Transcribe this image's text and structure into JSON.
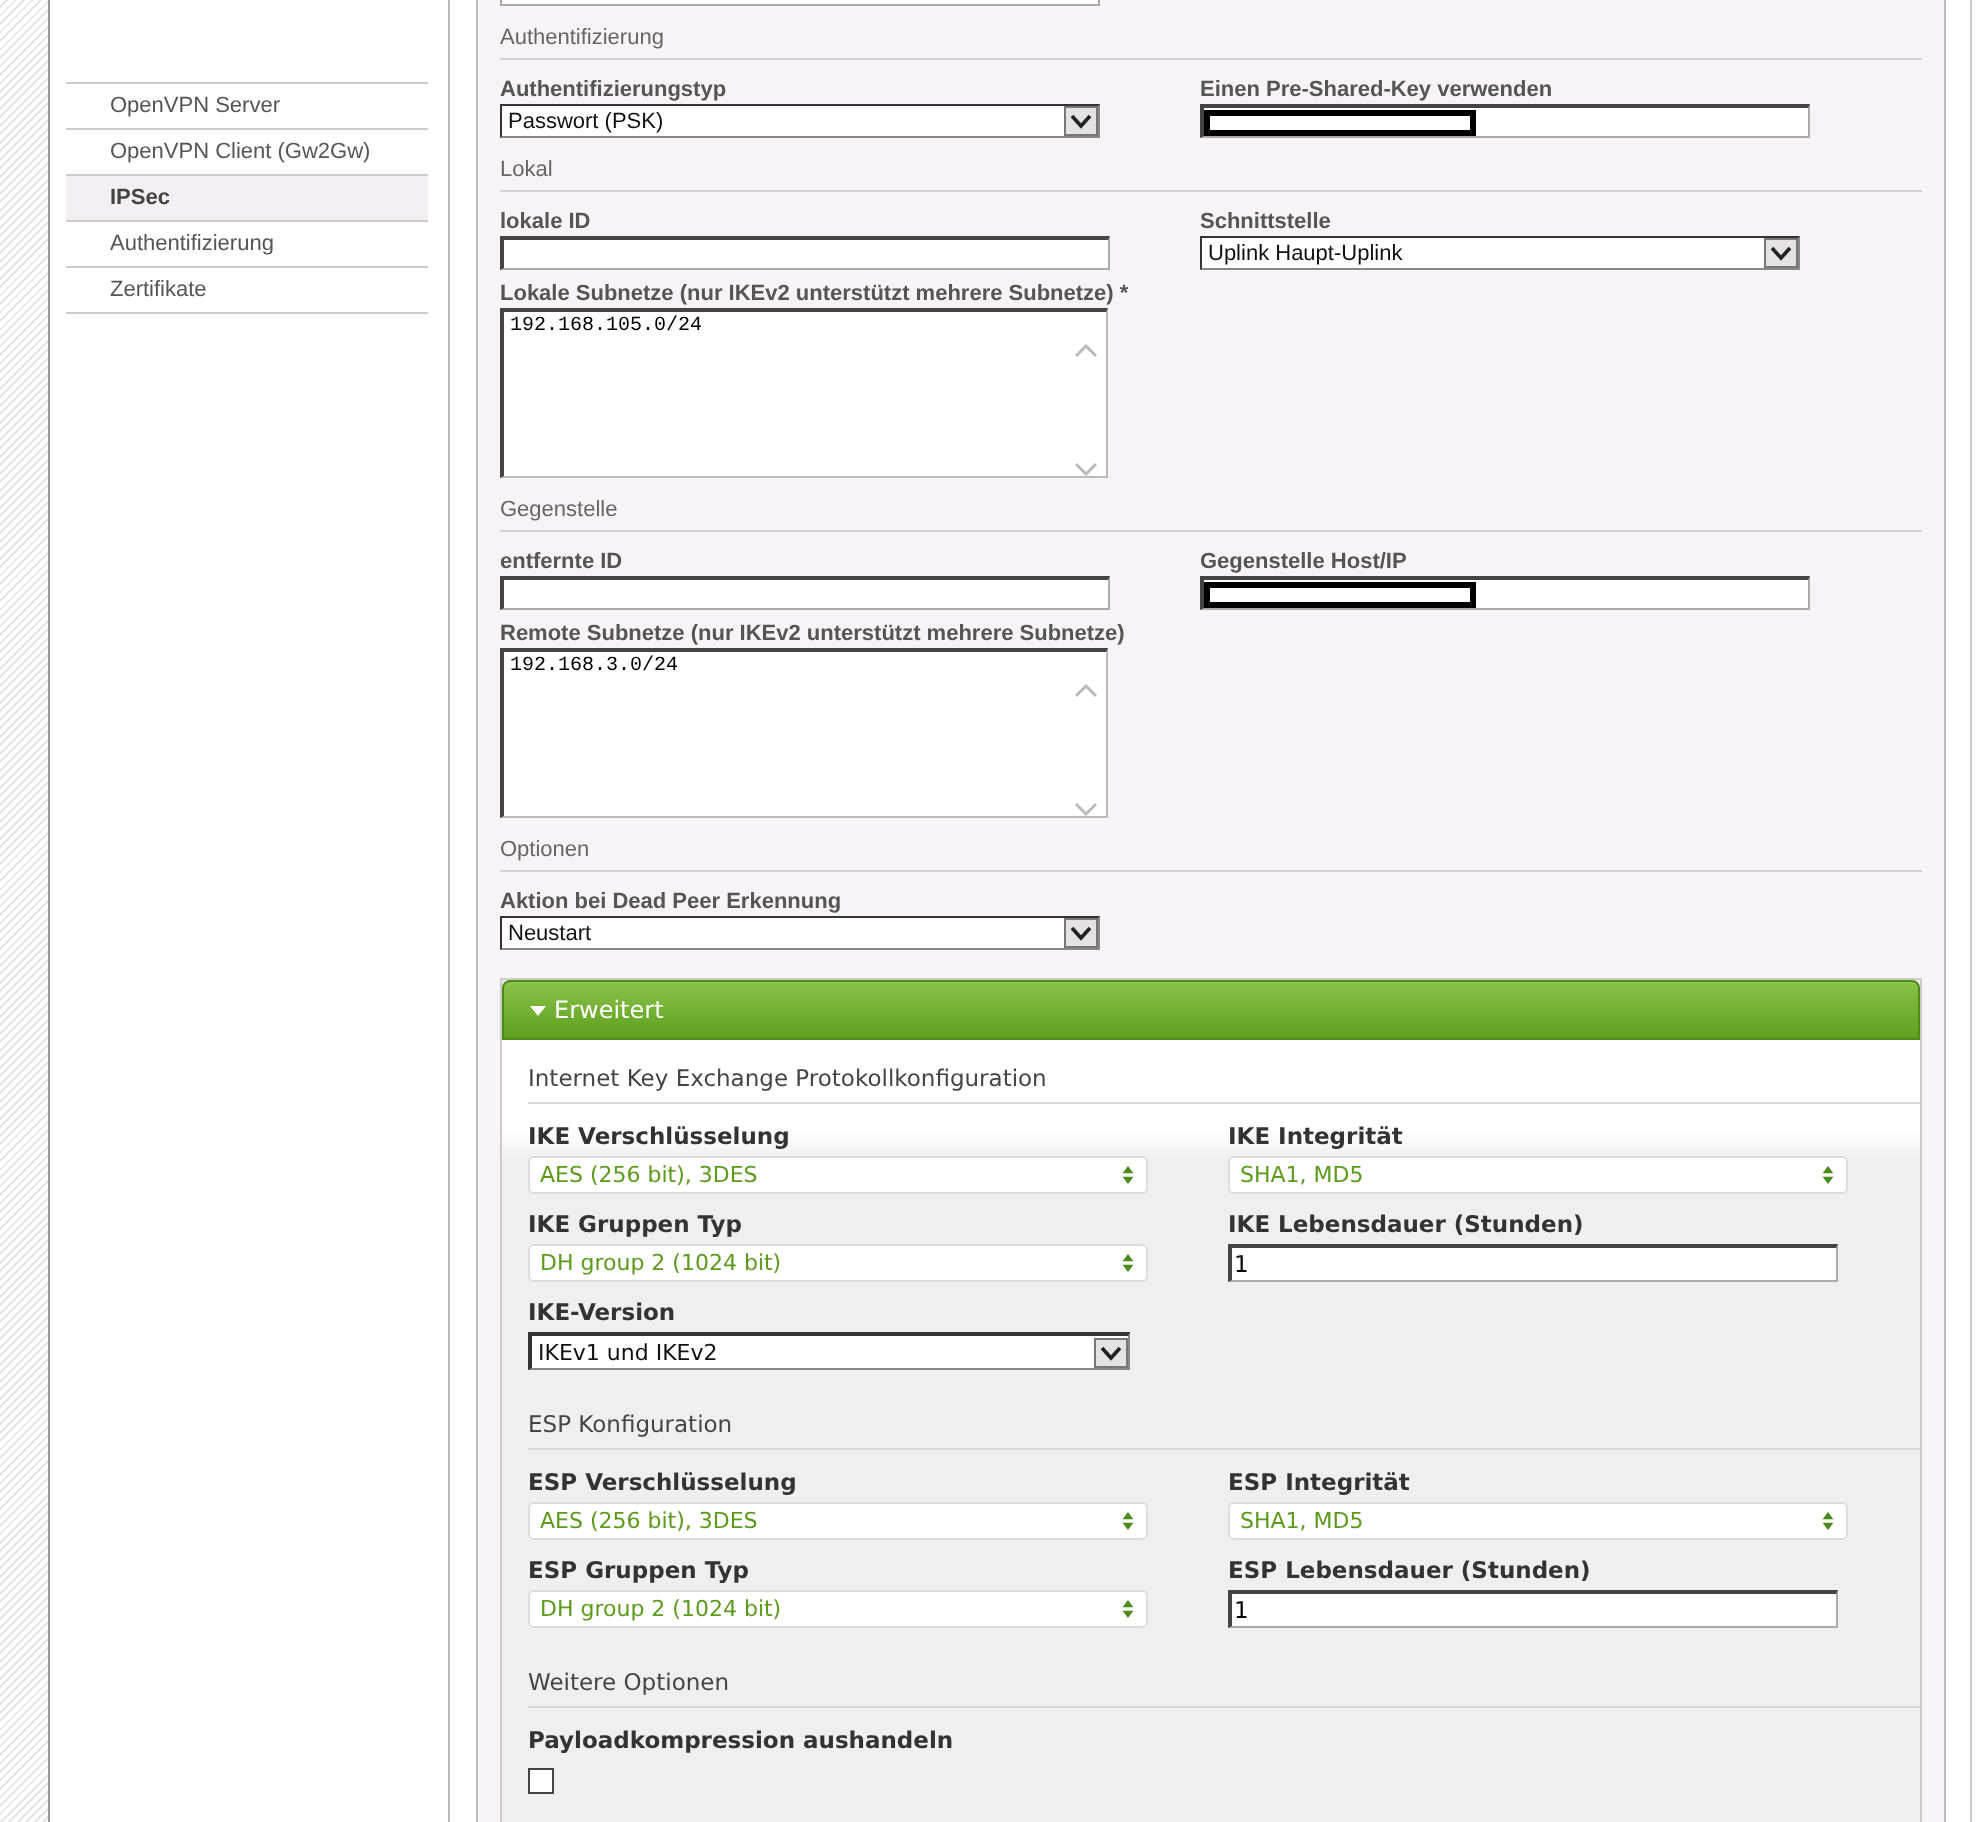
{
  "sidebar": {
    "items": [
      {
        "label": "OpenVPN Server",
        "selected": false
      },
      {
        "label": "OpenVPN Client (Gw2Gw)",
        "selected": false
      },
      {
        "label": "IPSec",
        "selected": true
      },
      {
        "label": "Authentifizierung",
        "selected": false
      },
      {
        "label": "Zertifikate",
        "selected": false
      }
    ]
  },
  "sections": [
    {
      "title": "Authentifizierung",
      "rows": [
        [
          {
            "kind": "select",
            "label": "Authentifizierungstyp",
            "value": "Passwort (PSK)"
          },
          {
            "kind": "text",
            "label": "Einen Pre-Shared-Key verwenden",
            "redacted": true
          }
        ]
      ]
    },
    {
      "title": "Lokal",
      "rows": [
        [
          {
            "kind": "text",
            "label": "lokale ID"
          },
          {
            "kind": "select",
            "label": "Schnittstelle",
            "value": "Uplink Haupt-Uplink"
          }
        ],
        [
          {
            "kind": "textarea",
            "label": "Lokale Subnetze (nur IKEv2 unterstützt mehrere Subnetze) *",
            "value": "192.168.105.0/24"
          }
        ]
      ]
    },
    {
      "title": "Gegenstelle",
      "rows": [
        [
          {
            "kind": "text",
            "label": "entfernte ID"
          },
          {
            "kind": "text",
            "label": "Gegenstelle Host/IP",
            "redacted": true
          }
        ],
        [
          {
            "kind": "textarea",
            "label": "Remote Subnetze (nur IKEv2 unterstützt mehrere Subnetze)",
            "value": "192.168.3.0/24"
          }
        ]
      ]
    },
    {
      "title": "Optionen",
      "rows": [
        [
          {
            "kind": "select",
            "label": "Aktion bei Dead Peer Erkennung",
            "value": "Neustart"
          }
        ]
      ]
    }
  ],
  "advanced": {
    "title": "Erweitert",
    "expanded": true,
    "sections": [
      {
        "title": "Internet Key Exchange Protokollkonfiguration",
        "rows": [
          [
            {
              "kind": "styled_select",
              "label": "IKE Verschlüsselung",
              "value": "AES (256 bit), 3DES"
            },
            {
              "kind": "styled_select",
              "label": "IKE Integrität",
              "value": "SHA1, MD5"
            }
          ],
          [
            {
              "kind": "styled_select",
              "label": "IKE Gruppen Typ",
              "value": "DH group 2 (1024 bit)"
            },
            {
              "kind": "text",
              "label": "IKE Lebensdauer (Stunden)",
              "value": "1"
            }
          ],
          [
            {
              "kind": "select",
              "label": "IKE-Version",
              "value": "IKEv1 und IKEv2"
            }
          ]
        ]
      },
      {
        "title": "ESP Konfiguration",
        "rows": [
          [
            {
              "kind": "styled_select",
              "label": "ESP Verschlüsselung",
              "value": "AES (256 bit), 3DES"
            },
            {
              "kind": "styled_select",
              "label": "ESP Integrität",
              "value": "SHA1, MD5"
            }
          ],
          [
            {
              "kind": "styled_select",
              "label": "ESP Gruppen Typ",
              "value": "DH group 2 (1024 bit)"
            },
            {
              "kind": "text",
              "label": "ESP Lebensdauer (Stunden)",
              "value": "1"
            }
          ]
        ]
      },
      {
        "title": "Weitere Optionen",
        "rows": [
          [
            {
              "kind": "checkbox",
              "label": "Payloadkompression aushandeln",
              "checked": false
            }
          ]
        ]
      }
    ]
  }
}
